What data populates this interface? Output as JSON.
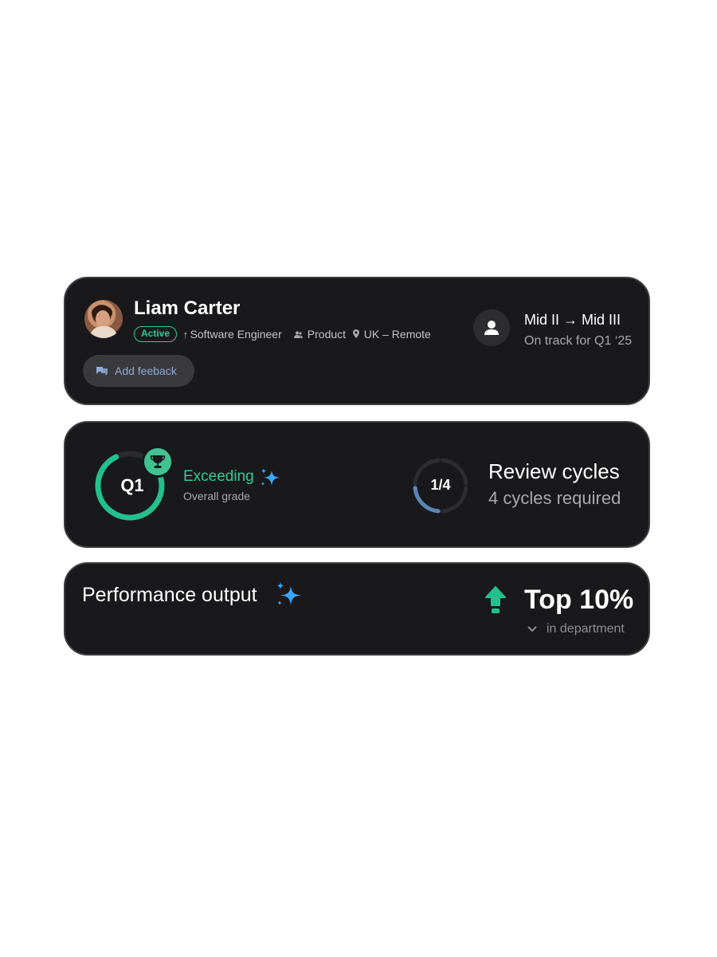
{
  "profile": {
    "name": "Liam Carter",
    "status_badge": "Active",
    "role": "Software Engineer",
    "team": "Product",
    "location": "UK – Remote",
    "feedback_button": "Add feeback",
    "level_transition": "Mid II → Mid III",
    "level_status": "On track for Q1 ‘25"
  },
  "grade": {
    "quarter": "Q1",
    "label": "Exceeding",
    "sub": "Overall grade",
    "progress": 0.83
  },
  "cycles": {
    "count_label": "1/4",
    "completed": 1,
    "total": 4,
    "title": "Review cycles",
    "sub": "4 cycles required"
  },
  "performance": {
    "title": "Performance output",
    "value": "Top 10%",
    "scope": "in department"
  },
  "colors": {
    "accent_green": "#2ecc9a",
    "sparkle_blue": "#38a8ff",
    "cycle_blue": "#5b87b8",
    "card_bg": "#19191b"
  },
  "icons": [
    "role-pin-icon",
    "team-icon",
    "location-pin-icon",
    "feedback-icon",
    "person-icon",
    "trophy-icon",
    "sparkle-icon",
    "arrow-up-icon",
    "chevron-down-icon"
  ]
}
